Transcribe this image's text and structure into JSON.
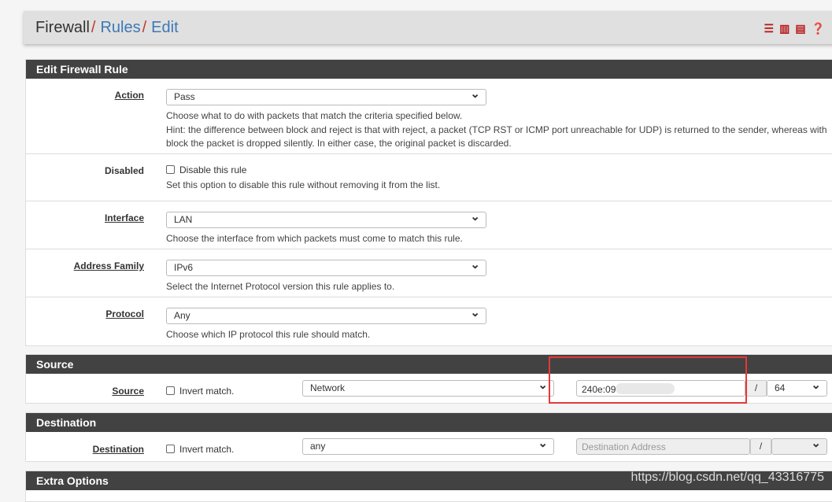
{
  "breadcrumb": {
    "root": "Firewall",
    "sep": "/",
    "items": [
      "Rules",
      "Edit"
    ]
  },
  "header_icons": [
    "sliders-icon",
    "bar-chart-icon",
    "list-icon",
    "help-icon"
  ],
  "edit_panel": {
    "title": "Edit Firewall Rule",
    "action": {
      "label": "Action",
      "value": "Pass",
      "help": [
        "Choose what to do with packets that match the criteria specified below.",
        "Hint: the difference between block and reject is that with reject, a packet (TCP RST or ICMP port unreachable for UDP) is returned to the sender, whereas with block the packet is dropped silently. In either case, the original packet is discarded."
      ]
    },
    "disabled": {
      "label": "Disabled",
      "checkbox": "Disable this rule",
      "help": "Set this option to disable this rule without removing it from the list."
    },
    "interface": {
      "label": "Interface",
      "value": "LAN",
      "help": "Choose the interface from which packets must come to match this rule."
    },
    "family": {
      "label": "Address Family",
      "value": "IPv6",
      "help": "Select the Internet Protocol version this rule applies to."
    },
    "protocol": {
      "label": "Protocol",
      "value": "Any",
      "help": "Choose which IP protocol this rule should match."
    }
  },
  "source": {
    "title": "Source",
    "label": "Source",
    "invert": "Invert match.",
    "type": "Network",
    "address": "240e:09",
    "slash": "/",
    "mask": "64",
    "highlight_color": "#e53935"
  },
  "destination": {
    "title": "Destination",
    "label": "Destination",
    "invert": "Invert match.",
    "type": "any",
    "address_placeholder": "Destination Address",
    "slash": "/",
    "mask": ""
  },
  "extra": {
    "title": "Extra Options"
  },
  "watermark": "https://blog.csdn.net/qq_43316775"
}
